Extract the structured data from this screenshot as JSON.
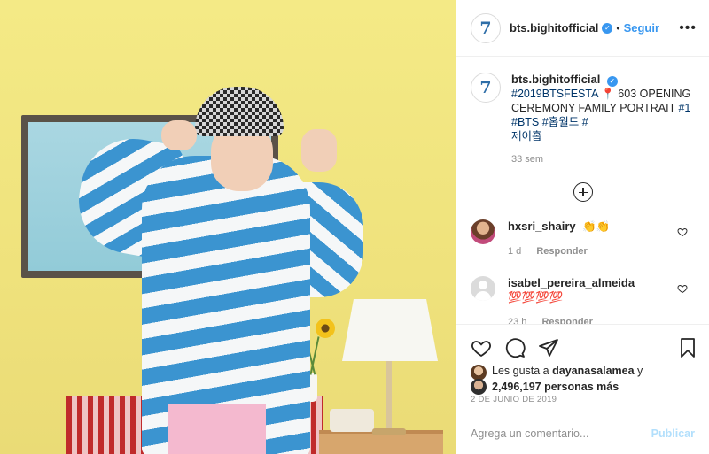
{
  "header": {
    "avatar_glyph": "7",
    "username": "bts.bighitofficial",
    "verified_icon": "verified-check-icon",
    "separator": "•",
    "follow_label": "Seguir",
    "more_icon": "more-options-icon",
    "more_glyph": "•••"
  },
  "caption": {
    "avatar_glyph": "7",
    "username": "bts.bighitofficial",
    "hashtag1": "#2019BTSFESTA",
    "pin_glyph": "📍",
    "text": "603 OPENING CEREMONY FAMILY PORTRAIT",
    "hashtag2": "#1",
    "hashtag3": "#BTS",
    "hashtag4": "#홉월드",
    "hashtag5": "#",
    "hashtag5_cont": "제이홉",
    "time": "33 sem"
  },
  "load_more": {
    "icon": "plus-circle-icon"
  },
  "comments": [
    {
      "username": "hxsri_shairy",
      "text": "👏👏",
      "time": "1 d",
      "reply_label": "Responder",
      "avatar": "user-photo-avatar"
    },
    {
      "username": "isabel_pereira_almeida",
      "text": "💯💯💯💯",
      "time": "23 h",
      "reply_label": "Responder",
      "avatar": "default-avatar"
    }
  ],
  "actions": {
    "like_icon": "heart-icon",
    "comment_icon": "comment-icon",
    "share_icon": "paper-plane-icon",
    "save_icon": "bookmark-icon"
  },
  "likes": {
    "prefix": "Les gusta a",
    "first_user": "dayanasalamea",
    "connector": "y",
    "count": "2,496,197 personas más"
  },
  "date": "2 DE JUNIO DE 2019",
  "add_comment": {
    "placeholder": "Agrega un comentario...",
    "publish_label": "Publicar"
  },
  "colors": {
    "link_blue": "#3897f0",
    "hashtag": "#003569",
    "muted": "#8e8e8e",
    "publish_disabled": "#b2dffc"
  }
}
